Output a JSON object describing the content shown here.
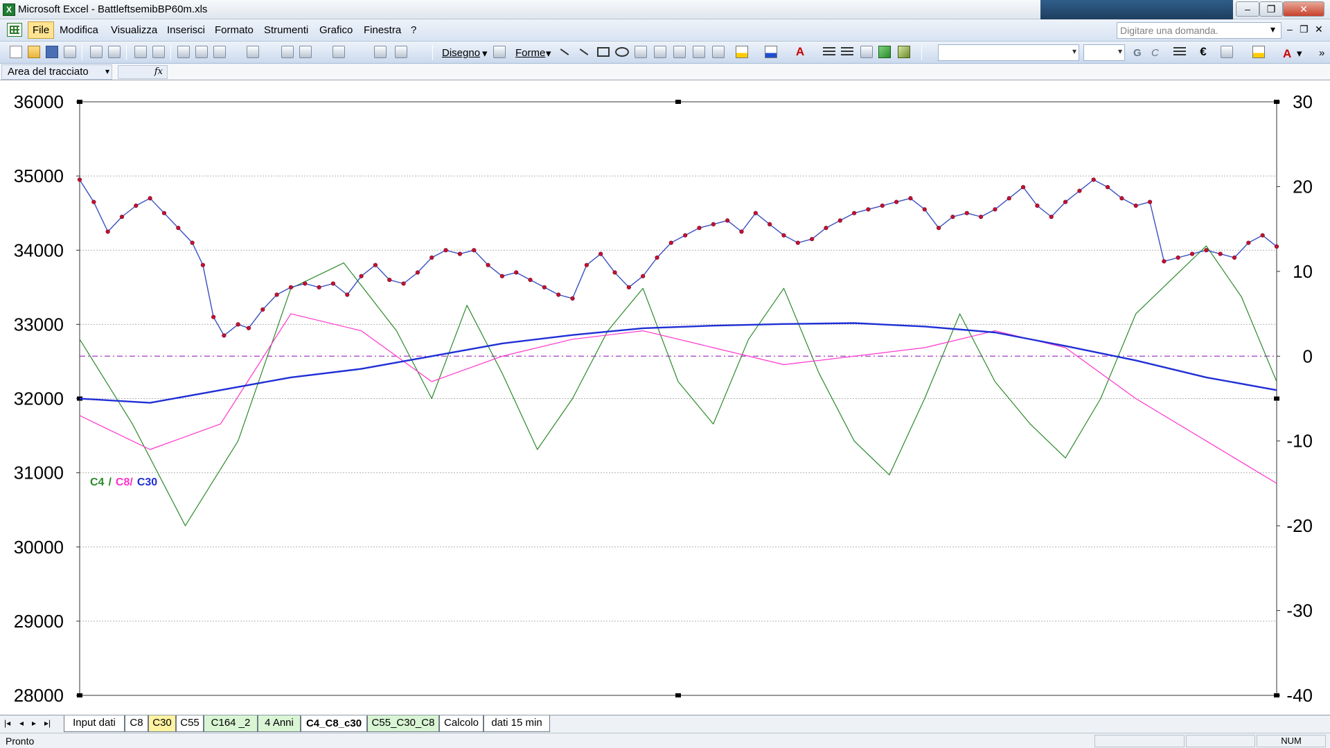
{
  "window": {
    "title": "Microsoft Excel - BattleftsemibBP60m.xls"
  },
  "window_controls": {
    "minimize": "–",
    "restore": "❐",
    "close": "✕"
  },
  "menu": {
    "items": [
      "File",
      "Modifica",
      "Visualizza",
      "Inserisci",
      "Formato",
      "Strumenti",
      "Grafico",
      "Finestra",
      "?"
    ],
    "help_placeholder": "Digitare una domanda."
  },
  "drawing_toolbar": {
    "drawing_label": "Disegno",
    "shapes_label": "Forme",
    "euro": "€",
    "bold": "G",
    "italic": "C",
    "font_color": "A"
  },
  "name_box": {
    "value": "Area del tracciato",
    "fx_label": "fx"
  },
  "sheet_tabs": [
    {
      "label": "Input dati",
      "style": "white"
    },
    {
      "label": "C8",
      "style": "white"
    },
    {
      "label": "C30",
      "style": "yellow"
    },
    {
      "label": "C55",
      "style": "white"
    },
    {
      "label": "C164 _2",
      "style": "green"
    },
    {
      "label": "4 Anni",
      "style": "green"
    },
    {
      "label": "C4_C8_c30",
      "style": "active"
    },
    {
      "label": "C55_C30_C8",
      "style": "green"
    },
    {
      "label": "Calcolo",
      "style": "white"
    },
    {
      "label": "dati 15 min",
      "style": "white"
    }
  ],
  "status": {
    "text": "Pronto",
    "num": "NUM"
  },
  "colors": {
    "price": "#c8102e",
    "price_line": "#3a4fc0",
    "c4": "#2a8a2a",
    "c8": "#ff33cc",
    "c30": "#1f2fd6",
    "zero_line": "#a03cc0"
  },
  "chart_data": {
    "type": "line",
    "title": "",
    "legend": [
      "C4",
      "/",
      "C8/",
      "C30"
    ],
    "legend_placement": "middle-left",
    "y_left": {
      "ticks": [
        36000,
        35000,
        34000,
        33000,
        32000,
        31000,
        30000,
        29000,
        28000
      ],
      "range": [
        28000,
        36000
      ]
    },
    "y_right": {
      "ticks": [
        30,
        20,
        10,
        0,
        -10,
        -20,
        -30,
        -40
      ],
      "range": [
        -40,
        30
      ]
    },
    "gridlines": "horizontal-dashed",
    "x_range": [
      0,
      340
    ],
    "series": [
      {
        "key": "price",
        "axis": "left",
        "markers": true,
        "points": [
          [
            0,
            34950
          ],
          [
            4,
            34650
          ],
          [
            8,
            34250
          ],
          [
            12,
            34450
          ],
          [
            16,
            34600
          ],
          [
            20,
            34700
          ],
          [
            24,
            34500
          ],
          [
            28,
            34300
          ],
          [
            32,
            34100
          ],
          [
            35,
            33800
          ],
          [
            38,
            33100
          ],
          [
            41,
            32850
          ],
          [
            45,
            33000
          ],
          [
            48,
            32950
          ],
          [
            52,
            33200
          ],
          [
            56,
            33400
          ],
          [
            60,
            33500
          ],
          [
            64,
            33550
          ],
          [
            68,
            33500
          ],
          [
            72,
            33550
          ],
          [
            76,
            33400
          ],
          [
            80,
            33650
          ],
          [
            84,
            33800
          ],
          [
            88,
            33600
          ],
          [
            92,
            33550
          ],
          [
            96,
            33700
          ],
          [
            100,
            33900
          ],
          [
            104,
            34000
          ],
          [
            108,
            33950
          ],
          [
            112,
            34000
          ],
          [
            116,
            33800
          ],
          [
            120,
            33650
          ],
          [
            124,
            33700
          ],
          [
            128,
            33600
          ],
          [
            132,
            33500
          ],
          [
            136,
            33400
          ],
          [
            140,
            33350
          ],
          [
            144,
            33800
          ],
          [
            148,
            33950
          ],
          [
            152,
            33700
          ],
          [
            156,
            33500
          ],
          [
            160,
            33650
          ],
          [
            164,
            33900
          ],
          [
            168,
            34100
          ],
          [
            172,
            34200
          ],
          [
            176,
            34300
          ],
          [
            180,
            34350
          ],
          [
            184,
            34400
          ],
          [
            188,
            34250
          ],
          [
            192,
            34500
          ],
          [
            196,
            34350
          ],
          [
            200,
            34200
          ],
          [
            204,
            34100
          ],
          [
            208,
            34150
          ],
          [
            212,
            34300
          ],
          [
            216,
            34400
          ],
          [
            220,
            34500
          ],
          [
            224,
            34550
          ],
          [
            228,
            34600
          ],
          [
            232,
            34650
          ],
          [
            236,
            34700
          ],
          [
            240,
            34550
          ],
          [
            244,
            34300
          ],
          [
            248,
            34450
          ],
          [
            252,
            34500
          ],
          [
            256,
            34450
          ],
          [
            260,
            34550
          ],
          [
            264,
            34700
          ],
          [
            268,
            34850
          ],
          [
            272,
            34600
          ],
          [
            276,
            34450
          ],
          [
            280,
            34650
          ],
          [
            284,
            34800
          ],
          [
            288,
            34950
          ],
          [
            292,
            34850
          ],
          [
            296,
            34700
          ],
          [
            300,
            34600
          ],
          [
            304,
            34650
          ],
          [
            308,
            33850
          ],
          [
            312,
            33900
          ],
          [
            316,
            33950
          ],
          [
            320,
            34000
          ],
          [
            324,
            33950
          ],
          [
            328,
            33900
          ],
          [
            332,
            34100
          ],
          [
            336,
            34200
          ],
          [
            340,
            34050
          ]
        ]
      },
      {
        "key": "c4",
        "axis": "right",
        "points": [
          [
            0,
            2
          ],
          [
            15,
            -8
          ],
          [
            30,
            -20
          ],
          [
            45,
            -10
          ],
          [
            60,
            8
          ],
          [
            75,
            11
          ],
          [
            90,
            3
          ],
          [
            100,
            -5
          ],
          [
            110,
            6
          ],
          [
            120,
            -2
          ],
          [
            130,
            -11
          ],
          [
            140,
            -5
          ],
          [
            150,
            3
          ],
          [
            160,
            8
          ],
          [
            170,
            -3
          ],
          [
            180,
            -8
          ],
          [
            190,
            2
          ],
          [
            200,
            8
          ],
          [
            210,
            -2
          ],
          [
            220,
            -10
          ],
          [
            230,
            -14
          ],
          [
            240,
            -5
          ],
          [
            250,
            5
          ],
          [
            260,
            -3
          ],
          [
            270,
            -8
          ],
          [
            280,
            -12
          ],
          [
            290,
            -5
          ],
          [
            300,
            5
          ],
          [
            310,
            9
          ],
          [
            320,
            13
          ],
          [
            330,
            7
          ],
          [
            340,
            -3
          ]
        ]
      },
      {
        "key": "c8",
        "axis": "right",
        "points": [
          [
            0,
            -7
          ],
          [
            20,
            -11
          ],
          [
            40,
            -8
          ],
          [
            60,
            5
          ],
          [
            80,
            3
          ],
          [
            100,
            -3
          ],
          [
            120,
            0
          ],
          [
            140,
            2
          ],
          [
            160,
            3
          ],
          [
            180,
            1
          ],
          [
            200,
            -1
          ],
          [
            220,
            0
          ],
          [
            240,
            1
          ],
          [
            260,
            3
          ],
          [
            280,
            1
          ],
          [
            300,
            -5
          ],
          [
            320,
            -10
          ],
          [
            340,
            -15
          ]
        ]
      },
      {
        "key": "c30",
        "axis": "right",
        "points": [
          [
            0,
            -5
          ],
          [
            20,
            -5.5
          ],
          [
            40,
            -4
          ],
          [
            60,
            -2.5
          ],
          [
            80,
            -1.5
          ],
          [
            100,
            0
          ],
          [
            120,
            1.5
          ],
          [
            140,
            2.5
          ],
          [
            160,
            3.3
          ],
          [
            180,
            3.6
          ],
          [
            200,
            3.8
          ],
          [
            220,
            3.9
          ],
          [
            240,
            3.5
          ],
          [
            260,
            2.8
          ],
          [
            280,
            1.2
          ],
          [
            300,
            -0.5
          ],
          [
            320,
            -2.5
          ],
          [
            340,
            -4
          ]
        ]
      }
    ]
  }
}
